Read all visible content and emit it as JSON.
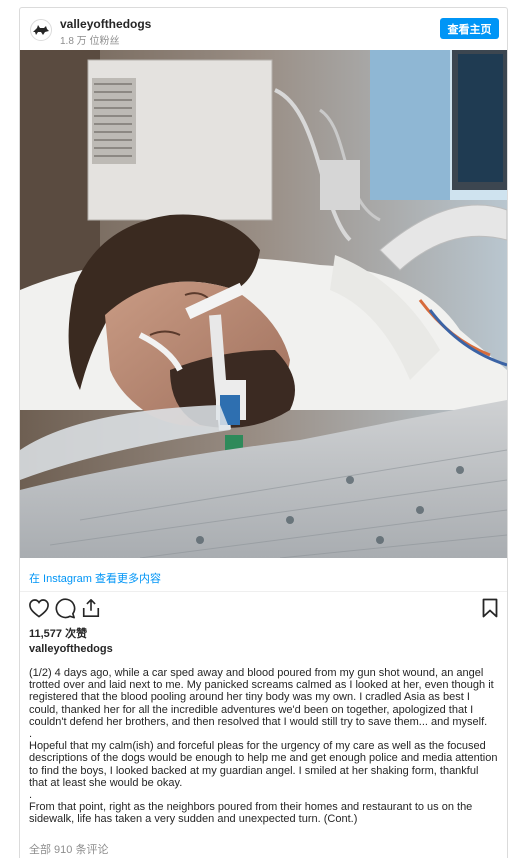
{
  "header": {
    "username": "valleyofthedogs",
    "followers": "1.8 万 位粉丝",
    "view_profile_label": "查看主页"
  },
  "post": {
    "view_more_label": "在 Instagram 查看更多内容",
    "likes": "11,577 次赞",
    "poster": "valleyofthedogs",
    "caption_paragraphs": [
      "(1/2) 4 days ago, while a car sped away and blood poured from my gun shot wound, an angel trotted over and laid next to me. My panicked screams calmed as I looked at her, even though it registered that the blood pooling around her tiny body was my own. I cradled Asia as best I could, thanked her for all the incredible adventures we'd been on together, apologized that I couldn't defend her brothers, and then resolved that I would still try to save them... and myself.",
      ".",
      "Hopeful that my calm(ish) and forceful pleas for the urgency of my care as well as the focused descriptions of the dogs would be enough to help me and get enough police and media attention to find the boys, I looked backed at my guardian angel. I smiled at her shaking form, thankful that at least she would be okay.",
      ".",
      "From that point, right as the neighbors poured from their homes and restaurant to us on the sidewalk, life has taken a very sudden and unexpected turn. (Cont.)"
    ],
    "comments_link": "全部 910 条评论"
  },
  "icons": {
    "avatar": "dog-logo-icon",
    "like": "heart-icon",
    "comment": "comment-bubble-icon",
    "share": "share-icon",
    "save": "bookmark-icon"
  },
  "colors": {
    "accent": "#0095f6",
    "text": "#262626",
    "muted": "#8e8e8e",
    "border": "#dbdbdb"
  }
}
